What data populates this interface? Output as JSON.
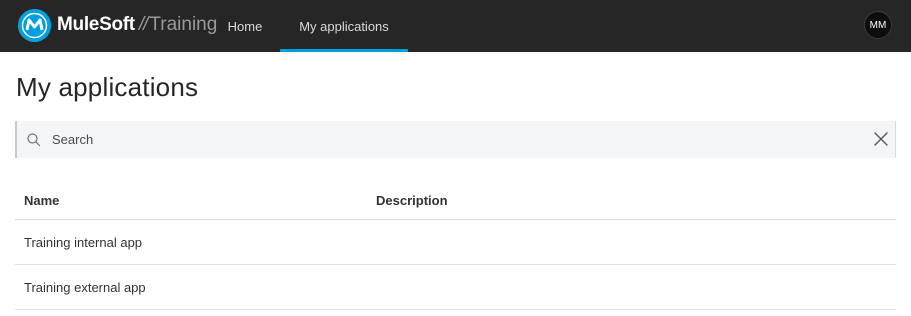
{
  "header": {
    "brand_name": "MuleSoft",
    "brand_separator": "//",
    "brand_sub": "Training",
    "nav": [
      {
        "label": "Home",
        "active": false
      },
      {
        "label": "My applications",
        "active": true
      }
    ],
    "user_initials": "MM"
  },
  "colors": {
    "topbar": "#262626",
    "accent": "#00a0df"
  },
  "page": {
    "title": "My applications"
  },
  "search": {
    "value": "",
    "placeholder": "Search"
  },
  "table": {
    "columns": [
      "Name",
      "Description"
    ],
    "rows": [
      {
        "name": "Training internal app",
        "description": ""
      },
      {
        "name": "Training external app",
        "description": ""
      }
    ]
  }
}
